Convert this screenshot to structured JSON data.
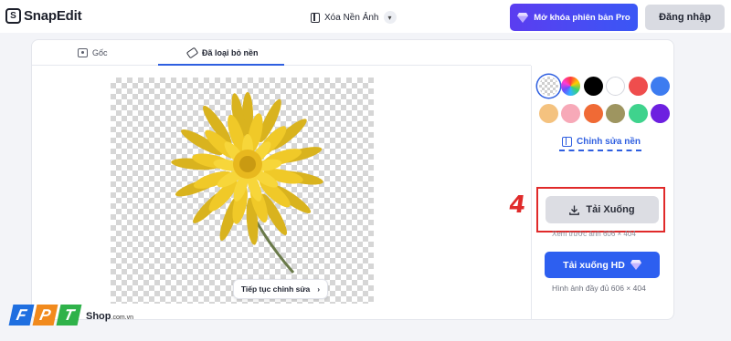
{
  "app": {
    "name": "SnapEdit",
    "logo_letter": "S"
  },
  "header": {
    "mode_label": "Xóa Nền Ảnh",
    "pro_button": "Mở khóa phiên bản Pro",
    "login_button": "Đăng nhập"
  },
  "tabs": [
    {
      "label": "Gốc",
      "selected": false
    },
    {
      "label": "Đã loại bỏ nền",
      "selected": true
    }
  ],
  "canvas": {
    "continue_label": "Tiếp tục chỉnh sửa",
    "continue_chevron": "›"
  },
  "colors": {
    "swatches": [
      {
        "name": "transparent",
        "hex": "transparent",
        "selected": true
      },
      {
        "name": "rainbow",
        "hex": "multicolor",
        "selected": false
      },
      {
        "name": "black",
        "hex": "#000000",
        "selected": false
      },
      {
        "name": "white",
        "hex": "#ffffff",
        "selected": false
      },
      {
        "name": "red",
        "hex": "#ef4d4d",
        "selected": false
      },
      {
        "name": "blue",
        "hex": "#3d7cf0",
        "selected": false
      },
      {
        "name": "peach",
        "hex": "#f4c27f",
        "selected": false
      },
      {
        "name": "pink",
        "hex": "#f7a9b8",
        "selected": false
      },
      {
        "name": "orange",
        "hex": "#f06a35",
        "selected": false
      },
      {
        "name": "olive",
        "hex": "#9e9560",
        "selected": false
      },
      {
        "name": "green",
        "hex": "#3fd38d",
        "selected": false
      },
      {
        "name": "purple",
        "hex": "#6d20e0",
        "selected": false
      }
    ]
  },
  "sidebar": {
    "edit_bg_label": "Chỉnh sửa nền",
    "step_number": "4",
    "download_label": "Tải Xuống",
    "preview_note": "Xem trước ảnh 606 × 404",
    "download_hd_label": "Tải xuống HD",
    "full_note": "Hình ảnh đầy đủ 606 × 404"
  },
  "watermark": {
    "letters": [
      "F",
      "P",
      "T"
    ],
    "shop": "Shop",
    "domain": ".com.vn"
  },
  "theme": {
    "accent": "#2f5fe0",
    "highlight": "#e02a2a",
    "flower": "#f3cf2a"
  }
}
